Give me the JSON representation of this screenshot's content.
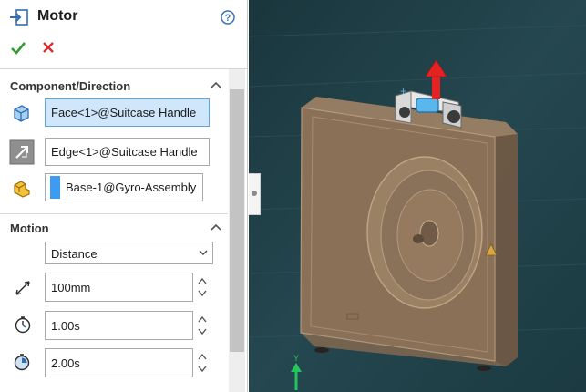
{
  "title": "Motor",
  "help_label": "?",
  "sections": {
    "component_direction": {
      "title": "Component/Direction",
      "face_ref": "Face<1>@Suitcase Handle",
      "edge_ref": "Edge<1>@Suitcase Handle",
      "component_ref": "Base-1@Gyro-Assembly"
    },
    "motion": {
      "title": "Motion",
      "type_selected": "Distance",
      "distance": "100mm",
      "start_time": "1.00s",
      "duration": "2.00s"
    }
  },
  "viewport": {
    "triad_axis_label": "Y"
  },
  "icons": {
    "pm": "motor-feature-icon",
    "ok": "check-icon",
    "cancel": "x-icon",
    "help": "help-circle-icon",
    "face": "face-selection-icon",
    "edge": "direction-arrow-icon",
    "component": "component-icon",
    "distance": "distance-icon",
    "start": "stopwatch-icon",
    "duration": "clock-duration-icon"
  },
  "colors": {
    "ok": "#2e9d2e",
    "cancel": "#d72d2d",
    "selection_active": "#cfe6fb",
    "swatch": "#3d9cf2",
    "direction_arrow": "#e52222",
    "model_tint": "#8c7258",
    "background": "#1f3d45"
  }
}
